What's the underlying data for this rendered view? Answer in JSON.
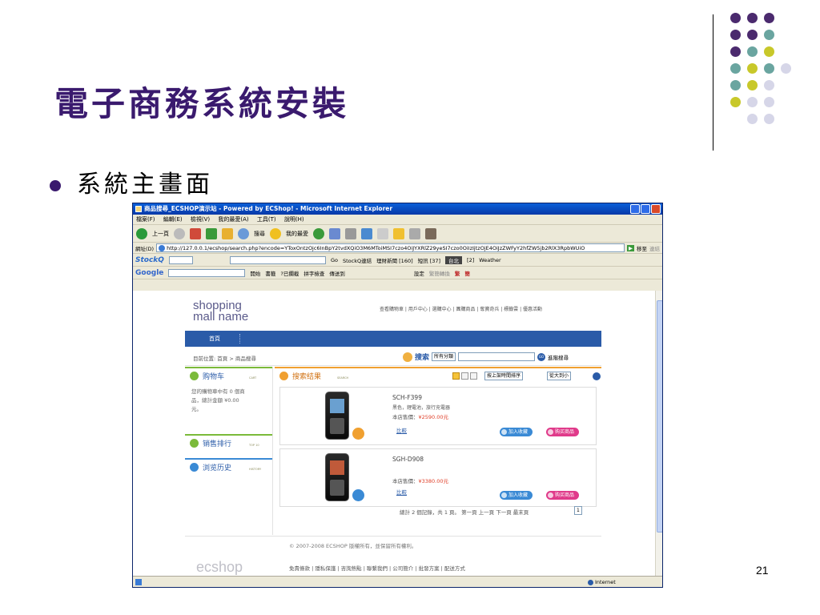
{
  "slide": {
    "title": "電子商務系統安裝",
    "bullet": "系統主畫面",
    "page_number": "21",
    "dot_colors": [
      "#4b2a6e",
      "#6aa5a0",
      "#c8c82a",
      "#d6d6e8"
    ]
  },
  "browser": {
    "window_title": "商品搜尋_ECSHOP演示站 - Powered by ECShop! - Microsoft Internet Explorer",
    "menu": [
      "檔案(F)",
      "編輯(E)",
      "檢視(V)",
      "我的最愛(A)",
      "工具(T)",
      "說明(H)"
    ],
    "toolbar": {
      "back": "上一頁",
      "search": "搜尋",
      "favorites": "我的最愛"
    },
    "address": {
      "label": "網址(D)",
      "url": "http://127.0.0.1/ecshop/search.php?encode=YToxOntzOjc6InBpY2tvdXQiO3M6MToiMSI7czo4OiJYXRlZ29yeSI7czo0OiIzIjtzOjE4OiJzZWFyY2hfZW5jb2RlX3RpbWUiO",
      "go": "移至",
      "links": "連結"
    },
    "stockq_bar": {
      "brand": "StockQ",
      "go": "Go",
      "stockq_link": "StockQ連結",
      "finance_news": "理財新聞 [160]",
      "short_news": "短訊 [37]",
      "city": "台北",
      "mail": "[2]",
      "weather": "Weather"
    },
    "google_bar": {
      "brand": "Google",
      "open": "開始",
      "bookmarks": "書籤",
      "blocked": "?已攔截",
      "spellcheck": "拼字檢查",
      "send_to": "傳送到",
      "settings": "設定",
      "convert": "繁簡轉換",
      "trad": "繁",
      "simp": "簡"
    },
    "status": {
      "internet": "Internet"
    }
  },
  "shop": {
    "logo_line1": "shopping",
    "logo_line2": "mall name",
    "top_links": "查看購物車 | 用戶中心 | 選購中心 | 團購商品 | 奪寶奇兵 | 標籤雲 | 優惠活動",
    "nav_home": "首頁",
    "breadcrumb": "目前位置: 首頁 > 商品搜尋",
    "search_label": "搜索",
    "search_category": "所有分類",
    "search_query": "",
    "advanced_search": "進階搜尋",
    "cart": {
      "title": "购物车",
      "en": "CART",
      "text1": "您的購物車中有 0 個商",
      "text2": "品，總計金額 ¥0.00",
      "text3": "元。"
    },
    "bestsellers": {
      "title": "销售排行",
      "en": "TOP 10"
    },
    "history": {
      "title": "浏览历史",
      "en": "HISTORY"
    },
    "results": {
      "title": "搜索结果",
      "en": "SEARCH",
      "sort_by": "按上架時間排序",
      "order": "從大到小"
    },
    "products": [
      {
        "name": "SCH-F399",
        "desc": "黑色，鋰電池，旅行充電器",
        "price_label": "本店售價：",
        "price": "¥2590.00元",
        "compare": "比較",
        "fav": "加入收藏",
        "buy": "购买商品"
      },
      {
        "name": "SGH-D908",
        "desc": "",
        "price_label": "本店售價：",
        "price": "¥3380.00元",
        "compare": "比較",
        "fav": "加入收藏",
        "buy": "购买商品"
      }
    ],
    "pager": "總計 2 個記錄，共 1 頁。 第一頁 上一頁 下一頁 最末頁",
    "page_select": "1",
    "footer_logo": "ecshop",
    "copyright": "© 2007-2008 ECSHOP 版權所有，並保留所有權利。",
    "footer_links": "免責條款 | 隱私保護 | 咨詢熱點 | 聯繫我們 | 公司簡介 | 批發方案 | 配送方式"
  }
}
